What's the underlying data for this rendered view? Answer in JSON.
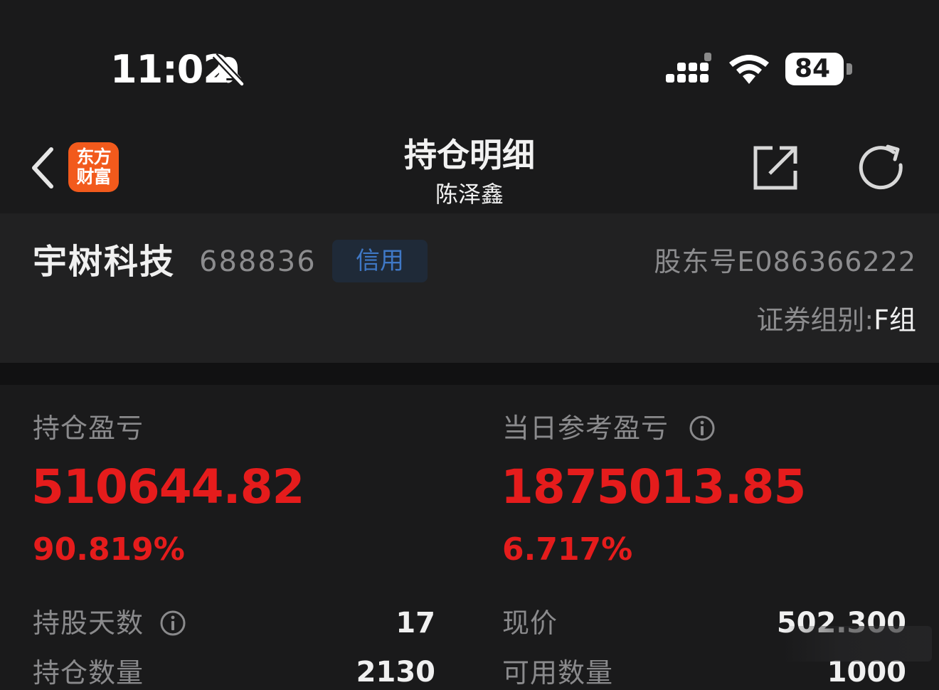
{
  "status_bar": {
    "time": "11:02",
    "battery": "84",
    "icons": [
      "bell-slash-icon",
      "signal-icon",
      "wifi-icon",
      "battery-icon"
    ]
  },
  "nav": {
    "logo_line1": "东方",
    "logo_line2": "财富",
    "title": "持仓明细",
    "subtitle": "陈泽鑫",
    "icons": [
      "back-chevron-icon",
      "share-icon",
      "refresh-icon"
    ]
  },
  "stock": {
    "name": "宇树科技",
    "code": "688836",
    "badge": "信用",
    "holder_no": "股东号E086366222",
    "group_label": "证券组别:",
    "group_value": "F组"
  },
  "pnl": {
    "position_label": "持仓盈亏",
    "position_value": "510644.82",
    "position_pct": "90.819%",
    "daily_label": "当日参考盈亏",
    "daily_value": "1875013.85",
    "daily_pct": "6.717%"
  },
  "details": {
    "days_label": "持股天数",
    "days_value": "17",
    "price_label": "现价",
    "price_value": "502.300",
    "qty_label": "持仓数量",
    "qty_value": "2130",
    "avail_label": "可用数量",
    "avail_value": "1000"
  },
  "colors": {
    "background": "#1a1a1b",
    "panel": "#212122",
    "accent_red": "#e51c1c",
    "brand_orange": "#f25a1c",
    "badge_blue": "#3f78c6"
  }
}
